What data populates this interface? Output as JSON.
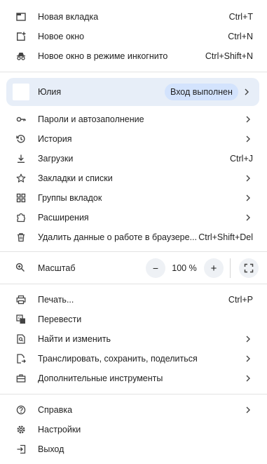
{
  "top_items": [
    {
      "icon": "new-tab-icon",
      "label": "Новая вкладка",
      "shortcut": "Ctrl+T"
    },
    {
      "icon": "new-window-icon",
      "label": "Новое окно",
      "shortcut": "Ctrl+N"
    },
    {
      "icon": "incognito-icon",
      "label": "Новое окно в режиме инкогнито",
      "shortcut": "Ctrl+Shift+N"
    }
  ],
  "profile": {
    "name": "Юлия",
    "status": "Вход выполнен"
  },
  "mid_items": [
    {
      "icon": "key-icon",
      "label": "Пароли и автозаполнение"
    },
    {
      "icon": "history-icon",
      "label": "История"
    },
    {
      "icon": "download-icon",
      "label": "Загрузки",
      "shortcut": "Ctrl+J"
    },
    {
      "icon": "star-icon",
      "label": "Закладки и списки"
    },
    {
      "icon": "tab-groups-icon",
      "label": "Группы вкладок"
    },
    {
      "icon": "extension-icon",
      "label": "Расширения"
    },
    {
      "icon": "trash-icon",
      "label": "Удалить данные о работе в браузере...",
      "shortcut": "Ctrl+Shift+Del"
    }
  ],
  "zoom": {
    "label": "Масштаб",
    "value": "100 %",
    "minus": "−",
    "plus": "+"
  },
  "tool_items": [
    {
      "icon": "print-icon",
      "label": "Печать...",
      "shortcut": "Ctrl+P"
    },
    {
      "icon": "translate-icon",
      "label": "Перевести"
    },
    {
      "icon": "find-icon",
      "label": "Найти и изменить"
    },
    {
      "icon": "cast-icon",
      "label": "Транслировать, сохранить, поделиться"
    },
    {
      "icon": "toolbox-icon",
      "label": "Дополнительные инструменты"
    }
  ],
  "bottom_items": [
    {
      "icon": "help-icon",
      "label": "Справка"
    },
    {
      "icon": "settings-icon",
      "label": "Настройки"
    },
    {
      "icon": "exit-icon",
      "label": "Выход"
    }
  ]
}
